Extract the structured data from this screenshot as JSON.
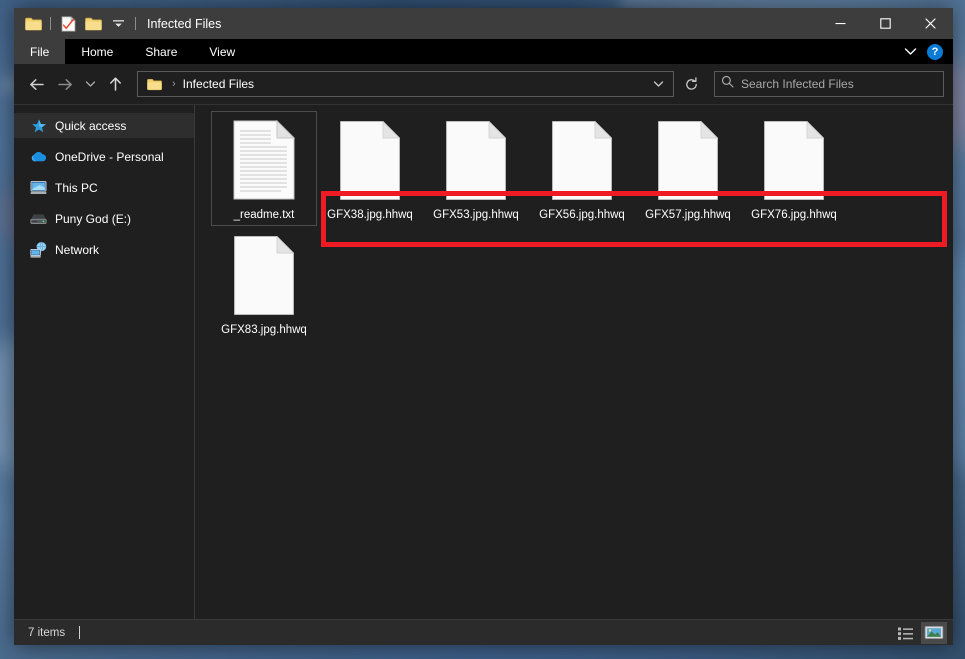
{
  "window": {
    "title": "Infected Files",
    "quick_access_toolbar": [
      {
        "name": "folder-icon",
        "label": "Properties of folder"
      },
      {
        "name": "properties-icon",
        "label": "Properties"
      },
      {
        "name": "new-folder-icon",
        "label": "New folder"
      },
      {
        "name": "customize-qat-icon",
        "label": "Customize Quick Access Toolbar"
      }
    ],
    "controls": {
      "minimize": "–",
      "maximize": "□",
      "close": "✕"
    }
  },
  "ribbon": {
    "tabs": [
      {
        "label": "File",
        "active": true
      },
      {
        "label": "Home",
        "active": false
      },
      {
        "label": "Share",
        "active": false
      },
      {
        "label": "View",
        "active": false
      }
    ],
    "expand_label": "⌄",
    "help_label": "?"
  },
  "navbar": {
    "back": "←",
    "forward": "→",
    "recent": "⌄",
    "up": "↑",
    "breadcrumb": {
      "separator": "›",
      "path": "Infected Files"
    },
    "dropdown": "⌄",
    "refresh": "↻"
  },
  "search": {
    "placeholder": "Search Infected Files",
    "value": "",
    "icon": "search-icon"
  },
  "sidebar": {
    "items": [
      {
        "label": "Quick access",
        "icon": "star-icon",
        "selected": true
      },
      {
        "label": "OneDrive - Personal",
        "icon": "cloud-icon",
        "selected": false
      },
      {
        "label": "This PC",
        "icon": "monitor-icon",
        "selected": false
      },
      {
        "label": "Puny God (E:)",
        "icon": "drive-icon",
        "selected": false
      },
      {
        "label": "Network",
        "icon": "network-icon",
        "selected": false
      }
    ]
  },
  "files": [
    {
      "name": "_readme.txt",
      "icon": "text-document-icon",
      "boxed": true
    },
    {
      "name": "GFX38.jpg.hhwq",
      "icon": "blank-document-icon",
      "boxed": false
    },
    {
      "name": "GFX53.jpg.hhwq",
      "icon": "blank-document-icon",
      "boxed": false
    },
    {
      "name": "GFX56.jpg.hhwq",
      "icon": "blank-document-icon",
      "boxed": false
    },
    {
      "name": "GFX57.jpg.hhwq",
      "icon": "blank-document-icon",
      "boxed": false
    },
    {
      "name": "GFX76.jpg.hhwq",
      "icon": "blank-document-icon",
      "boxed": false
    },
    {
      "name": "GFX83.jpg.hhwq",
      "icon": "blank-document-icon",
      "boxed": false
    }
  ],
  "annotation": {
    "color": "#ee1b24",
    "target": "encrypted file names"
  },
  "statusbar": {
    "item_count": "7 items",
    "views": [
      {
        "name": "details-view",
        "active": false
      },
      {
        "name": "large-icons-view",
        "active": true
      }
    ]
  },
  "colors": {
    "window_bg": "#1f1f1f",
    "titlebar_bg": "#3d3d3d",
    "ribbon_bg": "#000000",
    "accent_blue": "#0a7bd4",
    "annotation_red": "#ee1b24",
    "folder_yellow": "#f6d879"
  }
}
